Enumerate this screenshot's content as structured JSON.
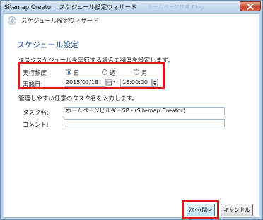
{
  "window": {
    "app_title": "Sitemap Creator",
    "dialog_title": "スケジュール設定ウィザード",
    "faded_title_text": "ホームページ作成 Blog"
  },
  "wizard": {
    "header": "スケジュール設定ウィザード",
    "page_title": "スケジュール設定",
    "frequency_description": "タスクスケジュールを実行する場合の頻度を設定します。"
  },
  "frequency": {
    "label": "実行頻度",
    "options": [
      {
        "label": "日",
        "selected": true
      },
      {
        "label": "週",
        "selected": false
      },
      {
        "label": "月",
        "selected": false
      }
    ]
  },
  "run_date": {
    "label": "実施日:",
    "date": "2015/03/18",
    "time": "16:00:00"
  },
  "task": {
    "description": "管理しやすい任意のタスク名を入力します。",
    "name_label": "タスク名:",
    "name_value": "ホームページビルダーSP - (Sitemap Creator)",
    "comment_label": "コメント:",
    "comment_value": ""
  },
  "buttons": {
    "next": "次へ(N)>",
    "cancel": "キャンセル"
  },
  "colors": {
    "highlight": "#e0141c",
    "page_title": "#1f4e9c",
    "frame": "#bdd6ee"
  }
}
